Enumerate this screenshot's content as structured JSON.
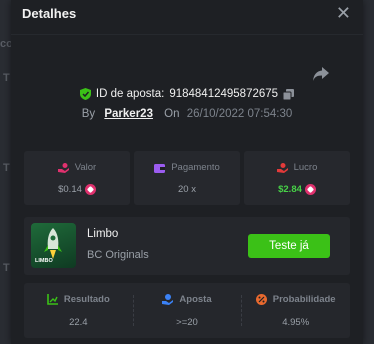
{
  "background": {
    "frag_top": "co",
    "frag_mid1": "T",
    "frag_mid2": "T",
    "frag_bot": "T"
  },
  "modal": {
    "title": "Detalhes",
    "close_symbol": "✕",
    "bet_id_label": "ID de aposta:",
    "bet_id": "91848412495872675",
    "by_label": "By",
    "user": "Parker23",
    "on_label": "On",
    "date": "26/10/2022 07:54:30"
  },
  "stats": [
    {
      "label": "Valor",
      "value": "$0.14",
      "icon": "money-hand-icon",
      "coin": true,
      "color": "#9aa0a8"
    },
    {
      "label": "Pagamento",
      "value": "20 x",
      "icon": "wallet-icon",
      "coin": false,
      "color": "#9aa0a8"
    },
    {
      "label": "Lucro",
      "value": "$2.84",
      "icon": "profit-icon",
      "coin": true,
      "color": "#47d147"
    }
  ],
  "game": {
    "thumb_label": "LIMBO",
    "name": "Limbo",
    "provider": "BC Originals",
    "try_label": "Teste já"
  },
  "results": [
    {
      "label": "Resultado",
      "value": "22.4",
      "icon": "result-icon"
    },
    {
      "label": "Aposta",
      "value": ">=20",
      "icon": "bet-icon"
    },
    {
      "label": "Probabilidade",
      "value": "4.95%",
      "icon": "percent-icon"
    }
  ],
  "colors": {
    "accent_green": "#3bc117",
    "coin_pink": "#e0316e",
    "profit_green": "#47d147"
  }
}
